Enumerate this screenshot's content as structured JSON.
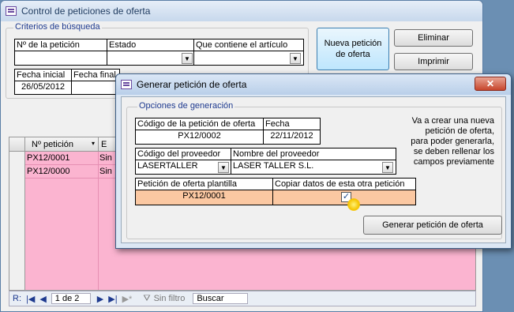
{
  "main_window": {
    "title": "Control de peticiones de oferta",
    "criteria_group": "Criterios de búsqueda",
    "col_numero": "Nº de la petición",
    "col_estado": "Estado",
    "col_articulo": "Que contiene el artículo",
    "col_fecha_inicial": "Fecha inicial",
    "col_fecha_final": "Fecha final",
    "fecha_inicial_value": "26/05/2012",
    "btn_nueva": "Nueva petición de oferta",
    "btn_eliminar": "Eliminar",
    "btn_imprimir": "Imprimir"
  },
  "list": {
    "header_numero": "Nº petición",
    "rows": [
      {
        "numero": "PX12/0001",
        "estado": "Sin"
      },
      {
        "numero": "PX12/0000",
        "estado": "Sin"
      }
    ]
  },
  "nav": {
    "label": "R:",
    "record": "1 de 2",
    "filter": "Sin filtro",
    "search_placeholder": "Buscar"
  },
  "dialog": {
    "title": "Generar petición de oferta",
    "group_label": "Opciones de generación",
    "codigo_label": "Código de la petición de oferta",
    "codigo_value": "PX12/0002",
    "fecha_label": "Fecha",
    "fecha_value": "22/11/2012",
    "proveedor_label": "Código del proveedor",
    "proveedor_value": "LASERTALLER",
    "nombre_label": "Nombre del proveedor",
    "nombre_value": "LASER TALLER S.L.",
    "plantilla_label": "Petición de oferta plantilla",
    "plantilla_value": "PX12/0001",
    "copiar_label": "Copiar datos de esta otra petición",
    "copiar_checked": true,
    "info_text": "Va a crear una nueva petición de oferta, para poder generarla, se deben rellenar los campos previamente",
    "btn_generar": "Generar petición de oferta",
    "close_symbol": "✕"
  }
}
